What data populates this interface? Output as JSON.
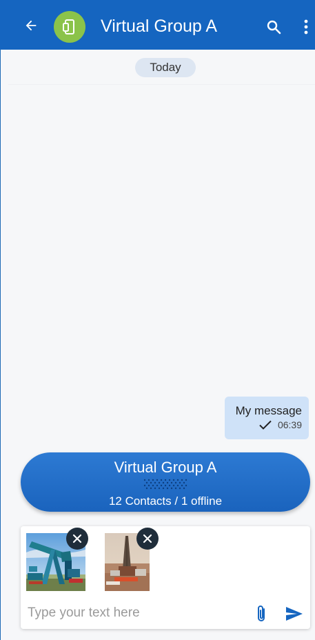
{
  "header": {
    "title": "Virtual Group A",
    "back_icon": "arrow-left-icon",
    "avatar_icon": "devices-icon",
    "search_icon": "search-icon",
    "menu_icon": "more-vert-icon",
    "bar_color": "#1565c0",
    "avatar_color": "#8bc34a"
  },
  "conversation": {
    "date_label": "Today",
    "messages": [
      {
        "text": "My message",
        "time": "06:39",
        "status": "sent",
        "status_icon": "check-icon"
      }
    ]
  },
  "group_banner": {
    "title": "Virtual Group A",
    "subtitle": "12 Contacts / 1 offline",
    "pattern_icon": "dot-grid-icon",
    "color": "#1a63bd"
  },
  "composer": {
    "placeholder": "Type your text here",
    "value": "",
    "attachments": [
      {
        "kind": "image",
        "subject": "pumpjack-photo",
        "remove_icon": "close-icon"
      },
      {
        "kind": "image",
        "subject": "drilling-rig-photo",
        "remove_icon": "close-icon"
      }
    ],
    "attach_icon": "paperclip-icon",
    "send_icon": "send-icon",
    "accent_color": "#1565c0"
  }
}
